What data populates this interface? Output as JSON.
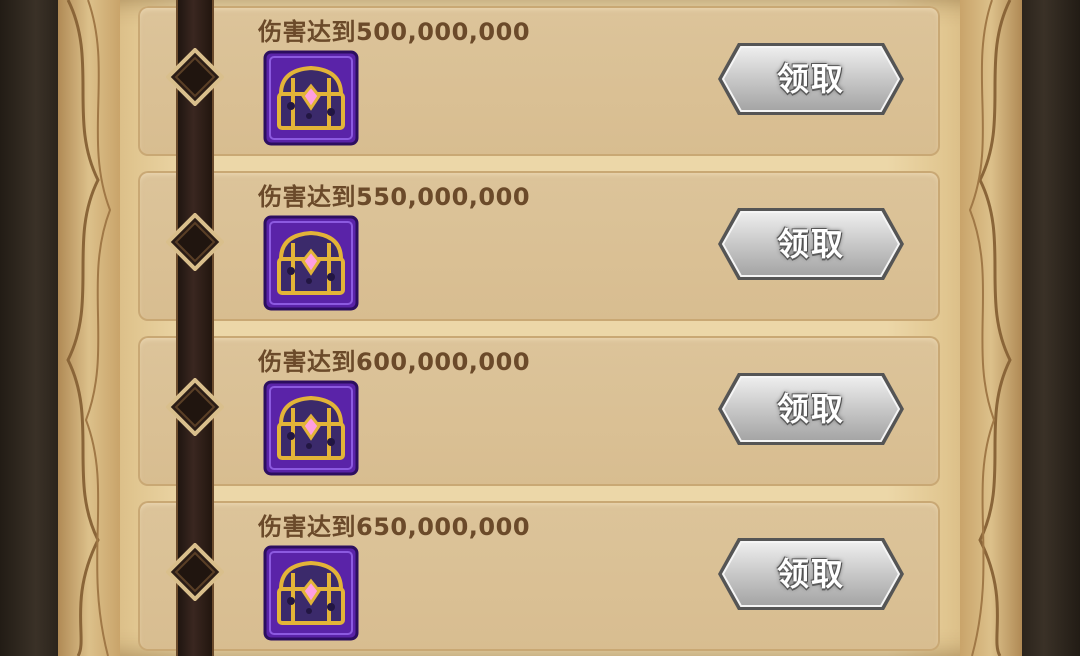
{
  "rewards": [
    {
      "title": "伤害达到500,000,000",
      "icon": "treasure-chest-icon",
      "button_label": "领取"
    },
    {
      "title": "伤害达到550,000,000",
      "icon": "treasure-chest-icon",
      "button_label": "领取"
    },
    {
      "title": "伤害达到600,000,000",
      "icon": "treasure-chest-icon",
      "button_label": "领取"
    },
    {
      "title": "伤害达到650,000,000",
      "icon": "treasure-chest-icon",
      "button_label": "领取"
    }
  ],
  "colors": {
    "parchment": "#ecd7a8",
    "row_background": "#d8bd90",
    "title_text": "#6b4a2a",
    "timeline": "#2b1d16",
    "chest_frame": "#4a1d8f",
    "button_silver": "#c9c9c9"
  }
}
